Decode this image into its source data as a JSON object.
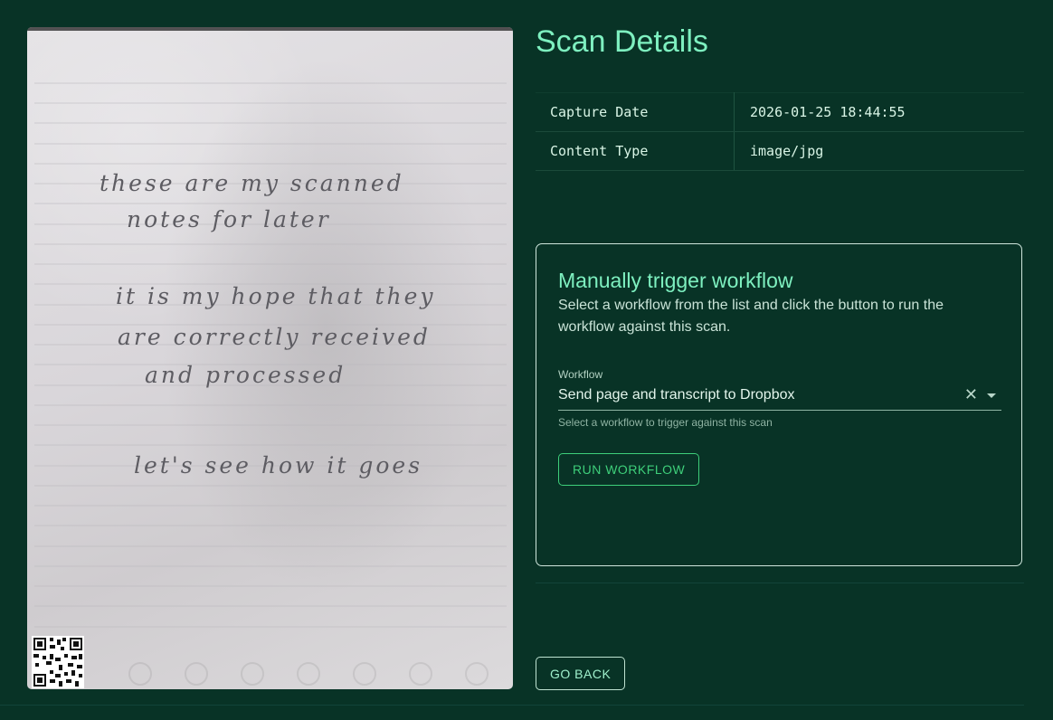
{
  "scan": {
    "handwriting": [
      "these are my scanned",
      "notes for later",
      "it is my hope that they",
      "are correctly received",
      "and processed",
      "let's see how it goes"
    ]
  },
  "details": {
    "title": "Scan Details",
    "rows": [
      {
        "key": "Capture Date",
        "value": "2026-01-25 18:44:55"
      },
      {
        "key": "Content Type",
        "value": "image/jpg"
      }
    ]
  },
  "workflow": {
    "title": "Manually trigger workflow",
    "description": "Select a workflow from the list and click the button to run the workflow against this scan.",
    "field_label": "Workflow",
    "selected": "Send page and transcript to Dropbox",
    "helper": "Select a workflow to trigger against this scan",
    "run_label": "RUN WORKFLOW"
  },
  "actions": {
    "back_label": "GO BACK"
  },
  "icons": {
    "clear": "close-icon",
    "dropdown": "caret-down-icon",
    "qr": "qr-code-icon"
  },
  "colors": {
    "background": "#083326",
    "accent": "#7ef0c0",
    "button_green": "#3ecf7a"
  }
}
